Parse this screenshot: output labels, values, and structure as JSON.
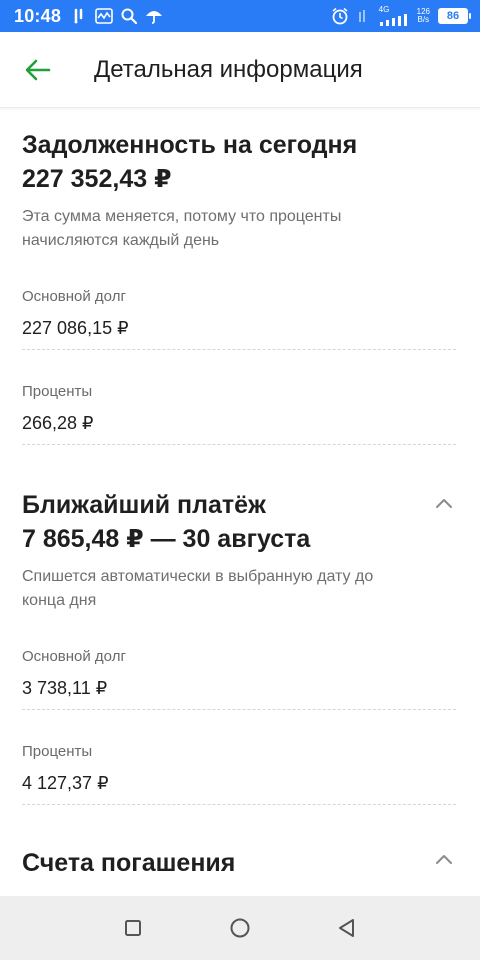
{
  "status_bar": {
    "time": "10:48",
    "left_icons": [
      "notification-icon",
      "activity-icon",
      "search-icon",
      "umbrella-icon"
    ],
    "right_icons": [
      "alarm-icon",
      "signal-icon"
    ],
    "network_type": "4G",
    "net_speed_value": "126",
    "net_speed_unit": "B/s",
    "battery": "86"
  },
  "app_bar": {
    "back_icon": "arrow-left-icon",
    "title": "Детальная информация",
    "accent_color": "#21a038"
  },
  "debt_today": {
    "title": "Задолженность на сегодня",
    "amount": "227 352,43 ₽",
    "note": "Эта сумма меняется, потому что проценты начисляются каждый день",
    "rows": [
      {
        "label": "Основной долг",
        "value": "227 086,15 ₽"
      },
      {
        "label": "Проценты",
        "value": "266,28 ₽"
      }
    ]
  },
  "next_payment": {
    "title": "Ближайший платёж",
    "amount": "7 865,48 ₽ — 30 августа",
    "note": "Спишется автоматически в выбранную дату до конца дня",
    "rows": [
      {
        "label": "Основной долг",
        "value": "3 738,11 ₽"
      },
      {
        "label": "Проценты",
        "value": "4 127,37 ₽"
      }
    ]
  },
  "repayment_accounts": {
    "title": "Счета погашения"
  },
  "nav_bar": {
    "icons": [
      "square-recents-icon",
      "circle-home-icon",
      "triangle-back-icon"
    ]
  }
}
